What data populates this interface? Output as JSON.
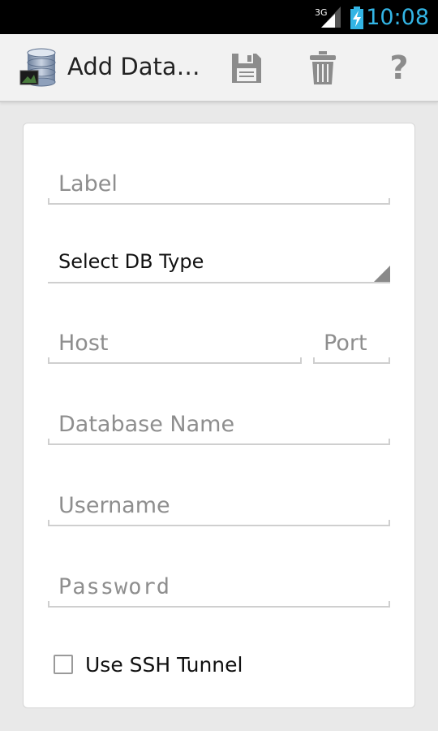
{
  "status_bar": {
    "network": "3G",
    "time": "10:08",
    "time_color": "#33b5e5"
  },
  "action_bar": {
    "title": "Add Data…",
    "icons": [
      "database-icon",
      "save-icon",
      "trash-icon",
      "help-icon"
    ],
    "help_label": "?"
  },
  "form": {
    "label_placeholder": "Label",
    "db_type": "Select DB Type",
    "host_placeholder": "Host",
    "port_placeholder": "Port",
    "database_placeholder": "Database Name",
    "username_placeholder": "Username",
    "password_placeholder": "Password",
    "ssh_label": "Use SSH Tunnel",
    "ssh_checked": false
  },
  "colors": {
    "status_bar": "#000000",
    "action_bar": "#f2f2f2",
    "background": "#e9e9e9",
    "card": "#ffffff",
    "accent": "#33b5e5"
  }
}
